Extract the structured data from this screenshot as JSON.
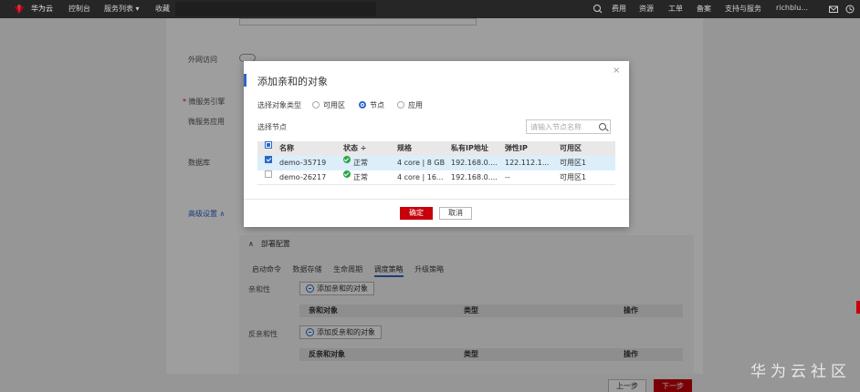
{
  "topbar": {
    "brand": "华为云",
    "nav": [
      "控制台",
      "服务列表 ▾",
      "收藏"
    ],
    "right_nav": [
      "费用",
      "资源",
      "工单",
      "备案",
      "支持与服务",
      "richblu..."
    ],
    "icons": [
      "search-icon",
      "mail-icon",
      "clock-icon"
    ]
  },
  "form": {
    "external_access_label": "外网访问",
    "engine_label": "微服务引擎",
    "app_label": "微服务应用",
    "database_label": "数据库",
    "advanced_link": "高级设置 ∧"
  },
  "deploy": {
    "header": "∧　部署配置",
    "tabs": [
      "启动命令",
      "数据存储",
      "生命周期",
      "调度策略",
      "升级策略"
    ],
    "active_tab": "调度策略",
    "affinity_label": "亲和性",
    "add_affinity_button": "添加亲和的对象",
    "affinity_columns": [
      "亲和对象",
      "类型",
      "操作"
    ],
    "anti_affinity_label": "反亲和性",
    "add_anti_affinity_button": "添加反亲和的对象",
    "anti_affinity_columns": [
      "反亲和对象",
      "类型",
      "操作"
    ]
  },
  "footer": {
    "prev": "上一步",
    "next": "下一步"
  },
  "watermark": "华为云社区",
  "modal": {
    "title": "添加亲和的对象",
    "close": "×",
    "type_label": "选择对象类型",
    "type_options": [
      "可用区",
      "节点",
      "应用"
    ],
    "selected_type": "节点",
    "node_label": "选择节点",
    "search_placeholder": "请输入节点名称",
    "columns": [
      "名称",
      "状态 ÷",
      "规格",
      "私有IP地址",
      "弹性IP",
      "可用区"
    ],
    "rows": [
      {
        "name": "demo-35719",
        "status": "正常",
        "spec": "4 core | 8 GB",
        "private_ip": "192.168.0....",
        "eip": "122.112.1...",
        "az": "可用区1",
        "checked": true
      },
      {
        "name": "demo-26217",
        "status": "正常",
        "spec": "4 core | 16...",
        "private_ip": "192.168.0....",
        "eip": "--",
        "az": "可用区1",
        "checked": false
      }
    ],
    "ok": "确定",
    "cancel": "取消"
  }
}
